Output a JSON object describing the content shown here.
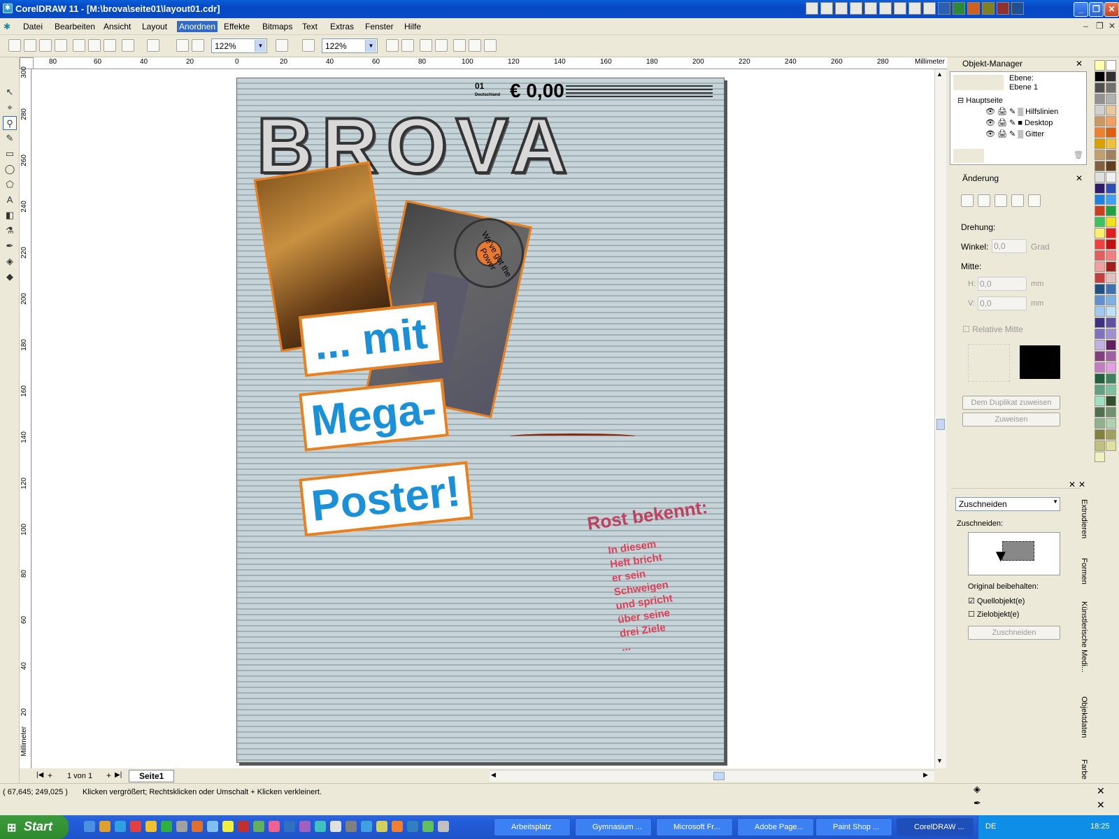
{
  "window": {
    "title": "CorelDRAW 11 - [M:\\brova\\seite01\\layout01.cdr]",
    "app_icon": "coreldraw-icon"
  },
  "menu": {
    "items": [
      "Datei",
      "Bearbeiten",
      "Ansicht",
      "Layout",
      "Anordnen",
      "Effekte",
      "Bitmaps",
      "Text",
      "Extras",
      "Fenster",
      "Hilfe"
    ],
    "active": "Anordnen"
  },
  "toolbar": {
    "zoom1": "122%",
    "zoom2": "122%"
  },
  "ruler": {
    "units": "Millimeter",
    "h_ticks": [
      "80",
      "60",
      "40",
      "20",
      "0",
      "20",
      "40",
      "60",
      "80",
      "100",
      "120",
      "140",
      "160",
      "180",
      "200",
      "220",
      "240",
      "260",
      "280"
    ],
    "v_ticks": [
      "300",
      "280",
      "260",
      "240",
      "220",
      "200",
      "180",
      "160",
      "140",
      "120",
      "100",
      "80",
      "60",
      "40",
      "20"
    ]
  },
  "document": {
    "headline": "BROVA",
    "price": "€ 0,00",
    "issue": "01",
    "country": "Deutschland",
    "stamp_text": "We've got the Power",
    "promo": [
      "... mit",
      "Mega-",
      "Poster!"
    ],
    "teaser_title": "Rost bekennt:",
    "teaser_body": "In diesem Heft bricht er sein Schweigen und spricht über seine drei Ziele ..."
  },
  "pages": {
    "counter": "1 von 1",
    "tab": "Seite1"
  },
  "status": {
    "coords": "( 67,645; 249,025 )",
    "hint": "Klicken vergrößert; Rechtsklicken oder Umschalt + Klicken verkleinert."
  },
  "object_manager": {
    "title": "Objekt-Manager",
    "layer_label": "Ebene:",
    "layer_name": "Ebene 1",
    "page": "Hauptseite",
    "layers": [
      "Hilfslinien",
      "Desktop",
      "Gitter"
    ]
  },
  "transform": {
    "title": "Änderung",
    "rotation": "Drehung:",
    "angle_label": "Winkel:",
    "angle_value": "0,0",
    "angle_unit": "Grad",
    "center": "Mitte:",
    "h_label": "H:",
    "h_value": "0,0",
    "v_label": "V:",
    "v_value": "0,0",
    "unit": "mm",
    "relative": "Relative Mitte",
    "btn_dup": "Dem Duplikat zuweisen",
    "btn_apply": "Zuweisen"
  },
  "shaping": {
    "mode": "Zuschneiden",
    "label": "Zuschneiden:",
    "keep": "Original beibehalten:",
    "source": "Quellobjekt(e)",
    "source_checked": true,
    "target": "Zielobjekt(e)",
    "target_checked": false,
    "btn": "Zuschneiden"
  },
  "side_tabs": [
    "Extrudieren",
    "Formen",
    "Künstlerische Medi...",
    "Objektdaten",
    "Farbe"
  ],
  "palette": [
    "#fffeb0",
    "#ffffff",
    "#000000",
    "#303030",
    "#505050",
    "#707070",
    "#909090",
    "#b0b0b0",
    "#d0d0d0",
    "#e8c8a0",
    "#c89860",
    "#f0a060",
    "#f08030",
    "#e06010",
    "#d8a000",
    "#f0c040",
    "#c0a070",
    "#a08060",
    "#806040",
    "#604020",
    "#e0e0e0",
    "#f0f0f0",
    "#301a6a",
    "#3050b0",
    "#2080e0",
    "#40a0f0",
    "#c84020",
    "#20a040",
    "#40c060",
    "#f0e020",
    "#f8f070",
    "#e02020",
    "#f04040",
    "#c01010",
    "#e06060",
    "#f08080",
    "#f0a0a0",
    "#a02020",
    "#c04040",
    "#e0c0c0",
    "#205080",
    "#4070b0",
    "#6090d0",
    "#80b0e0",
    "#a0c8f0",
    "#c0e0f8",
    "#403080",
    "#6050a0",
    "#8070c0",
    "#a090d0",
    "#c0b0e0",
    "#602060",
    "#804080",
    "#a060a0",
    "#c080c0",
    "#e0a0e0",
    "#206040",
    "#408060",
    "#60a080",
    "#80c0a0",
    "#a0e0c0",
    "#305030",
    "#507050",
    "#709070",
    "#90b090",
    "#b0d0b0",
    "#808040",
    "#a0a060",
    "#c0c080",
    "#e0e0a0",
    "#f0f0c0"
  ],
  "taskbar": {
    "start": "Start",
    "tasks": [
      "Arbeitsplatz",
      "Gymnasium ...",
      "Microsoft Fr...",
      "Adobe Page...",
      "Paint Shop ...",
      "CorelDRAW ..."
    ],
    "lang": "DE",
    "time": "18:25"
  }
}
